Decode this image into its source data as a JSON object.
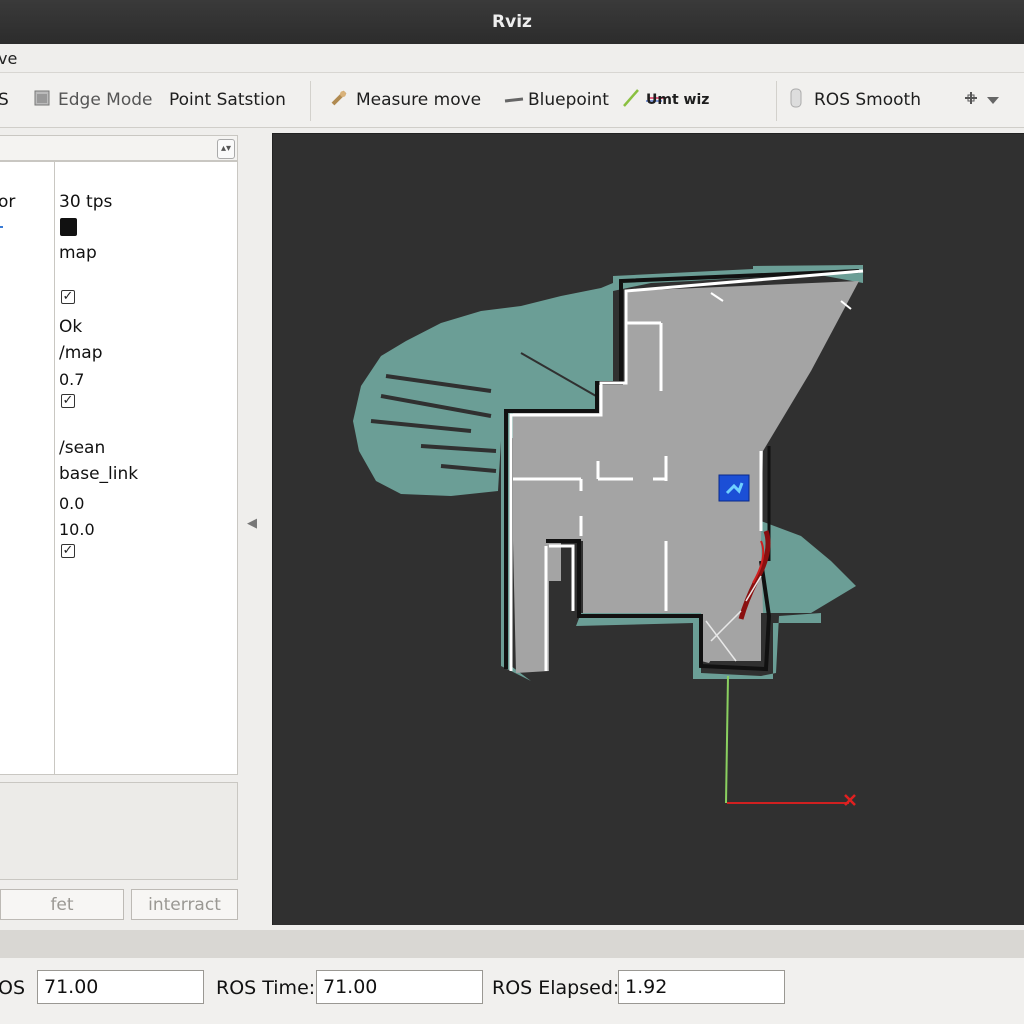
{
  "window": {
    "title": "Rviz"
  },
  "menu": {
    "partial_item": "ve"
  },
  "toolbar": {
    "items": [
      {
        "label": "S",
        "icon": "truncated-tool"
      },
      {
        "label": "Edge Mode",
        "icon": "square-icon"
      },
      {
        "label": "Point Satstion",
        "icon": ""
      },
      {
        "label": "Measure move",
        "icon": "ruler-icon"
      },
      {
        "label": "Bluepoint",
        "icon": "line-icon"
      },
      {
        "label": "Umt wiz",
        "icon": "pencil-icon"
      },
      {
        "label": "ROS Smooth",
        "icon": "cylinder-icon"
      }
    ],
    "overflow_icon": "move-icon"
  },
  "properties": {
    "left_fragments": {
      "row1": "or"
    },
    "values": {
      "fps": "30 tps",
      "frame": "map",
      "status": "Ok",
      "topic": "/map",
      "alpha": "0.7",
      "ns": "/sean",
      "link": "base_link",
      "offset": "0.0",
      "size": "10.0"
    },
    "checkbox_mark": "✓"
  },
  "panel_buttons": {
    "set": "fet",
    "interact": "interract"
  },
  "time": {
    "ros_label_fragment": "OS",
    "ros_value": "71.00",
    "ros_time_label": "ROS Time:",
    "ros_time_value": "71.00",
    "ros_elapsed_label": "ROS Elapsed:",
    "ros_elapsed_value": "1.92"
  },
  "colors": {
    "viewport_bg": "#303030",
    "map_free": "#a4a4a4",
    "map_unknown": "#6b9e96",
    "map_wall": "#111111",
    "robot": "#1b4fd6",
    "axis_x": "#d02020",
    "axis_y": "#8ad060"
  }
}
